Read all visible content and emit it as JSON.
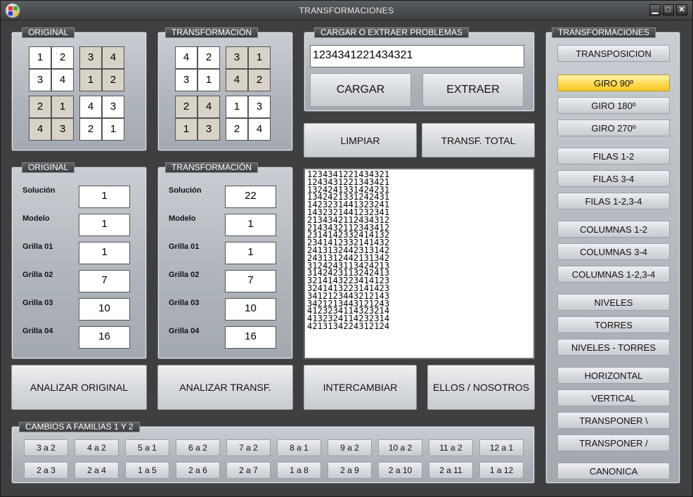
{
  "window": {
    "title": "TRANSFORMACIONES",
    "min": "▁",
    "max": "□",
    "close": "✕"
  },
  "original_grid": {
    "title": "ORIGINAL",
    "blocks": [
      [
        "1",
        "2",
        "3",
        "4"
      ],
      [
        "3",
        "4",
        "1",
        "2"
      ],
      [
        "2",
        "1",
        "4",
        "3"
      ],
      [
        "4",
        "3",
        "2",
        "1"
      ]
    ]
  },
  "transf_grid": {
    "title": "TRANSFORMACIÓN",
    "blocks": [
      [
        "4",
        "2",
        "3",
        "1"
      ],
      [
        "3",
        "1",
        "4",
        "2"
      ],
      [
        "2",
        "4",
        "1",
        "3"
      ],
      [
        "1",
        "3",
        "2",
        "4"
      ]
    ]
  },
  "load": {
    "title": "CARGAR O EXTRAER PROBLEMAS",
    "value": "1234341221434321",
    "cargar": "CARGAR",
    "extraer": "EXTRAER"
  },
  "actions": {
    "limpiar": "LIMPIAR",
    "transf_total": "TRANSF. TOTAL",
    "analizar_original": "ANALIZAR ORIGINAL",
    "analizar_transf": "ANALIZAR TRANSF.",
    "intercambiar": "INTERCAMBIAR",
    "ellos": "ELLOS / NOSOTROS"
  },
  "original_info": {
    "title": "ORIGINAL",
    "labels": [
      "Solución",
      "Modelo",
      "Grilla 01",
      "Grilla 02",
      "Grilla 03",
      "Grilla 04"
    ],
    "values": [
      "1",
      "1",
      "1",
      "7",
      "10",
      "16"
    ]
  },
  "transf_info": {
    "title": "TRANSFORMACIÓN",
    "labels": [
      "Solución",
      "Modelo",
      "Grilla 01",
      "Grilla 02",
      "Grilla 03",
      "Grilla 04"
    ],
    "values": [
      "22",
      "1",
      "1",
      "7",
      "10",
      "16"
    ]
  },
  "list": [
    "1234341221434321",
    "1243431221343421",
    "1324241331424231",
    "1342421331242431",
    "1423231441323241",
    "1432321441232341",
    "2134342112434312",
    "2143432112343412",
    "2314142332414132",
    "2341412332141432",
    "2413132442313142",
    "2431312442131342",
    "3124243113424213",
    "3142423113242413",
    "3214143223414123",
    "3241413223141423",
    "3412123443212143",
    "3421213443121243",
    "4123234114323214",
    "4132324114232314",
    "4213134224312124"
  ],
  "families": {
    "title": "CAMBIOS A FAMILIAS 1 Y 2",
    "row1": [
      "3 a 2",
      "4 a 2",
      "5 a 1",
      "6 a 2",
      "7 a 2",
      "8 a 1",
      "9 a 2",
      "10 a 2",
      "11 a 2",
      "12 a 1"
    ],
    "row2": [
      "2 a 3",
      "2 a 4",
      "1 a 5",
      "2 a 6",
      "2 a 7",
      "1 a 8",
      "2 a 9",
      "2 a 10",
      "2 a 11",
      "1 a 12"
    ]
  },
  "transforms": {
    "title": "TRANSFORMACIONES",
    "items": [
      "TRANSPOSICION",
      "GIRO 90º",
      "GIRO 180º",
      "GIRO 270º",
      "FILAS 1-2",
      "FILAS 3-4",
      "FILAS 1-2,3-4",
      "COLUMNAS 1-2",
      "COLUMNAS 3-4",
      "COLUMNAS 1-2,3-4",
      "NIVELES",
      "TORRES",
      "NIVELES - TORRES",
      "HORIZONTAL",
      "VERTICAL",
      "TRANSPONER  \\",
      "TRANSPONER  /",
      "CANONICA"
    ],
    "selected": "GIRO 90º"
  },
  "colors": {
    "highlight": "#ffd84a",
    "panel": "#b7bcc2",
    "window": "#3d3f41"
  }
}
